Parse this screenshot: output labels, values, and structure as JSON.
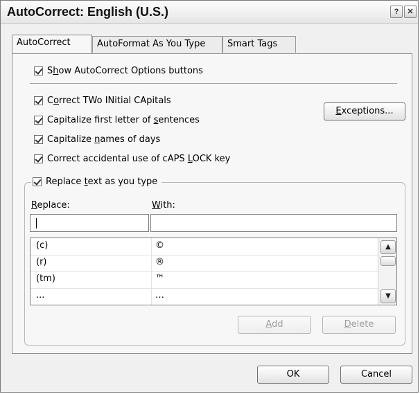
{
  "window": {
    "title": "AutoCorrect: English (U.S.)",
    "help_glyph": "?",
    "close_glyph": "✕"
  },
  "tabs": [
    {
      "label": "AutoCorrect",
      "active": true
    },
    {
      "label": "AutoFormat As You Type",
      "active": false
    },
    {
      "label": "Smart Tags",
      "active": false
    }
  ],
  "options": {
    "show_buttons": {
      "pre": "S",
      "u": "h",
      "post": "ow AutoCorrect Options buttons",
      "checked": true
    },
    "two_initial": {
      "pre": "C",
      "u": "o",
      "post": "rrect TWo INitial CApitals",
      "checked": true
    },
    "first_letter": {
      "pre": "Capitalize first letter of ",
      "u": "s",
      "post": "entences",
      "checked": true
    },
    "days": {
      "pre": "Capitalize ",
      "u": "n",
      "post": "ames of days",
      "checked": true
    },
    "caps_lock": {
      "pre": "Correct accidental use of cAPS ",
      "u": "L",
      "post": "OCK key",
      "checked": true
    },
    "replace_text": {
      "pre": "Replace ",
      "u": "t",
      "post": "ext as you type",
      "checked": true
    }
  },
  "exceptions_button": {
    "u": "E",
    "post": "xceptions..."
  },
  "replace_label": {
    "u": "R",
    "post": "eplace:"
  },
  "with_label": {
    "u": "W",
    "post": "ith:"
  },
  "replace_value": "",
  "with_value": "",
  "entries": [
    {
      "replace": "(c)",
      "with": "©"
    },
    {
      "replace": "(r)",
      "with": "®"
    },
    {
      "replace": "(tm)",
      "with": "™"
    },
    {
      "replace": "...",
      "with": "…"
    }
  ],
  "add_button": {
    "u": "A",
    "post": "dd"
  },
  "delete_button": {
    "u": "D",
    "post": "elete"
  },
  "ok_label": "OK",
  "cancel_label": "Cancel"
}
